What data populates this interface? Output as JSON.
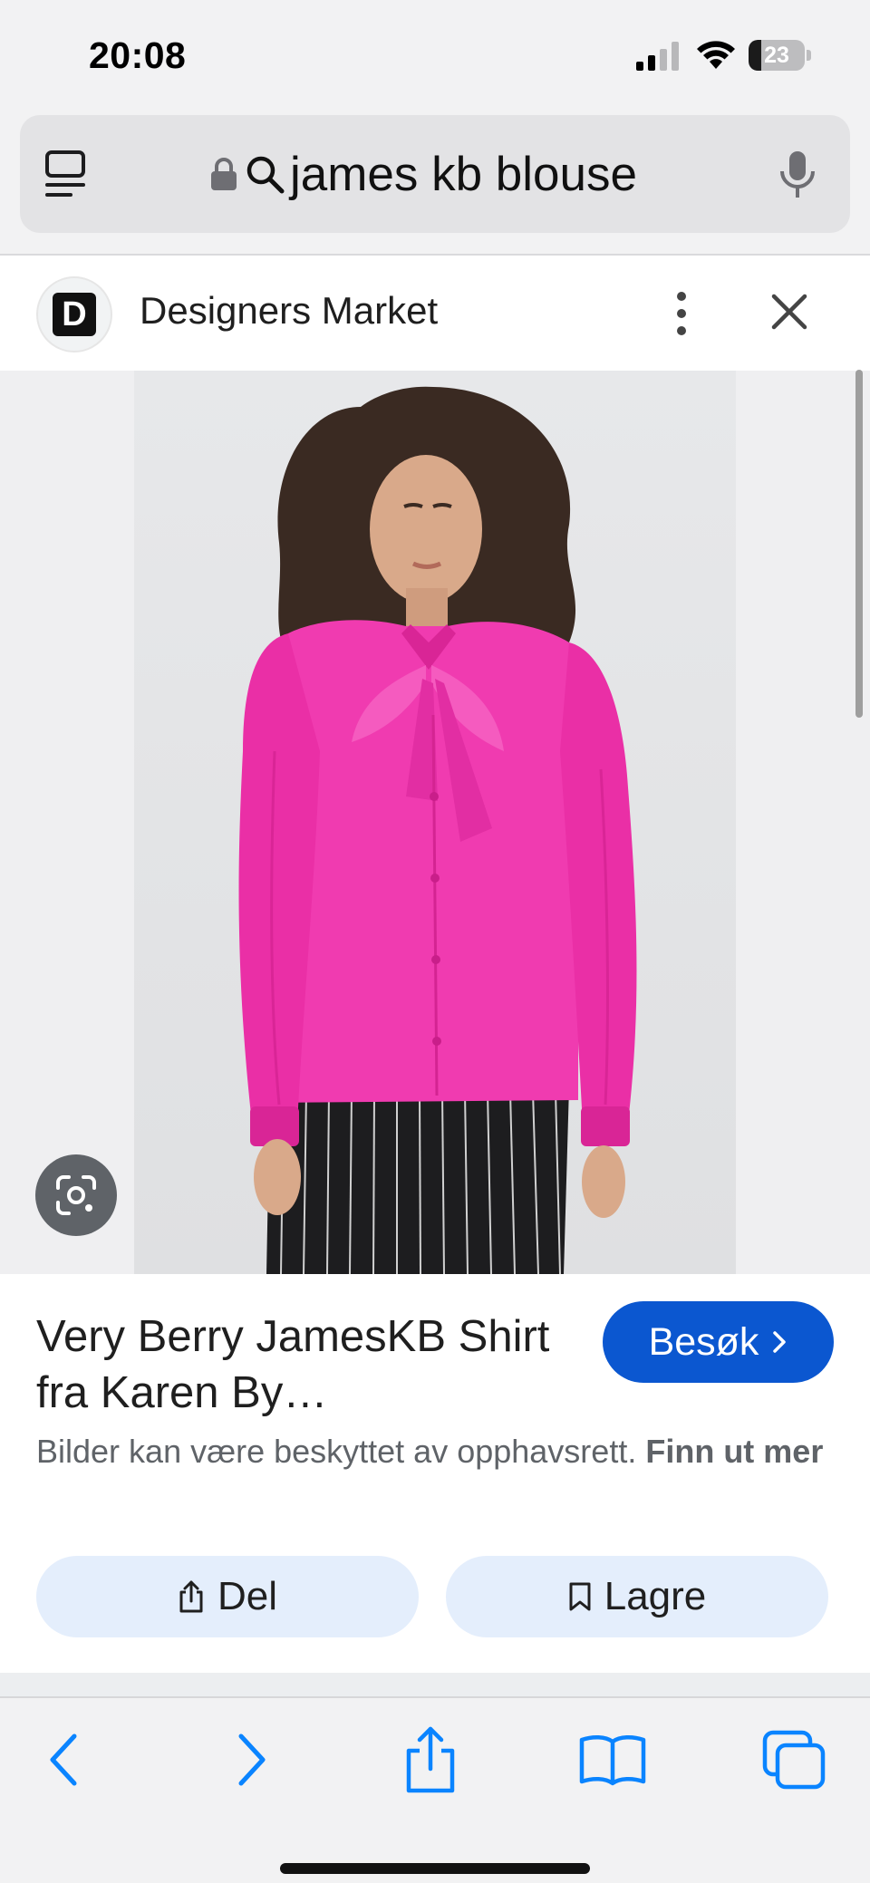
{
  "status_bar": {
    "time": "20:08",
    "battery": "23",
    "battery_level": 0.23
  },
  "address_bar": {
    "query": "james kb blouse"
  },
  "panel": {
    "site_name": "Designers Market",
    "logo_letter": "D"
  },
  "product": {
    "title": "Very Berry JamesKB Shirt fra Karen By…",
    "visit_label": "Besøk",
    "copyright_text": "Bilder kan være beskyttet av opphavsrett.",
    "learn_more": "Finn ut mer",
    "share_label": "Del",
    "save_label": "Lagre"
  },
  "colors": {
    "accent": "#0b57d0",
    "pill_bg": "#e4eefc",
    "toolbar_icon": "#0a84ff",
    "blouse": "#f03bb0"
  },
  "toolbar": {
    "icons": [
      "back-icon",
      "forward-icon",
      "share-icon",
      "bookmarks-icon",
      "tabs-icon"
    ]
  }
}
